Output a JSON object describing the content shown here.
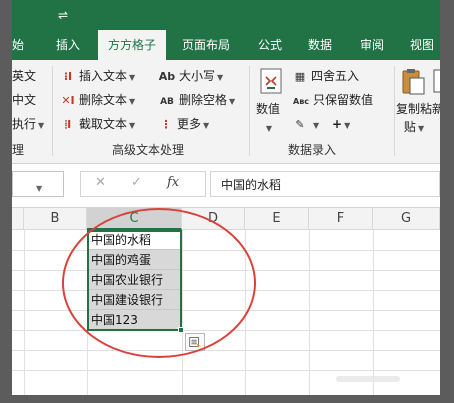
{
  "titlebar": {
    "qat_symbol": "⇌"
  },
  "tabs": [
    {
      "id": "start",
      "label": "开始",
      "visible_fragment": "始"
    },
    {
      "id": "insert",
      "label": "插入"
    },
    {
      "id": "fangfang",
      "label": "方方格子",
      "active": true
    },
    {
      "id": "layout",
      "label": "页面布局"
    },
    {
      "id": "formula",
      "label": "公式"
    },
    {
      "id": "data",
      "label": "数据"
    },
    {
      "id": "review",
      "label": "审阅"
    },
    {
      "id": "view",
      "label": "视图"
    }
  ],
  "ribbon": {
    "left_edge_items": [
      "英文",
      "中文",
      "执行"
    ],
    "left_edge_footer": "理",
    "text_group": {
      "label": "高级文本处理",
      "insert_text": "插入文本",
      "delete_text": "删除文本",
      "extract_text": "截取文本",
      "case": "大小写",
      "delete_spaces": "删除空格",
      "more": "更多",
      "case_icon": "Ab",
      "spaces_icon": "AB"
    },
    "number_group": {
      "label": "数据录入",
      "numeric": "数值",
      "round": "四舍五入",
      "keep_numbers": "只保留数值",
      "keep_icon": "Aвc",
      "plus": "+"
    },
    "clipboard": {
      "copy_paste_line1": "复制粘",
      "copy_paste_line2": "贴",
      "new_fragment": "新"
    }
  },
  "formula_bar": {
    "cancel_symbol": "✕",
    "confirm_symbol": "✓",
    "fx_symbol": "fx",
    "value": "中国的水稻"
  },
  "grid": {
    "columns": [
      "B",
      "C",
      "D",
      "E",
      "F",
      "G"
    ],
    "selected_column": "C",
    "cells": [
      "中国的水稻",
      "中国的鸡蛋",
      "中国农业银行",
      "中国建设银行",
      "中国123"
    ]
  },
  "colors": {
    "excel_green": "#217346",
    "annotation_red": "#d9433c"
  }
}
